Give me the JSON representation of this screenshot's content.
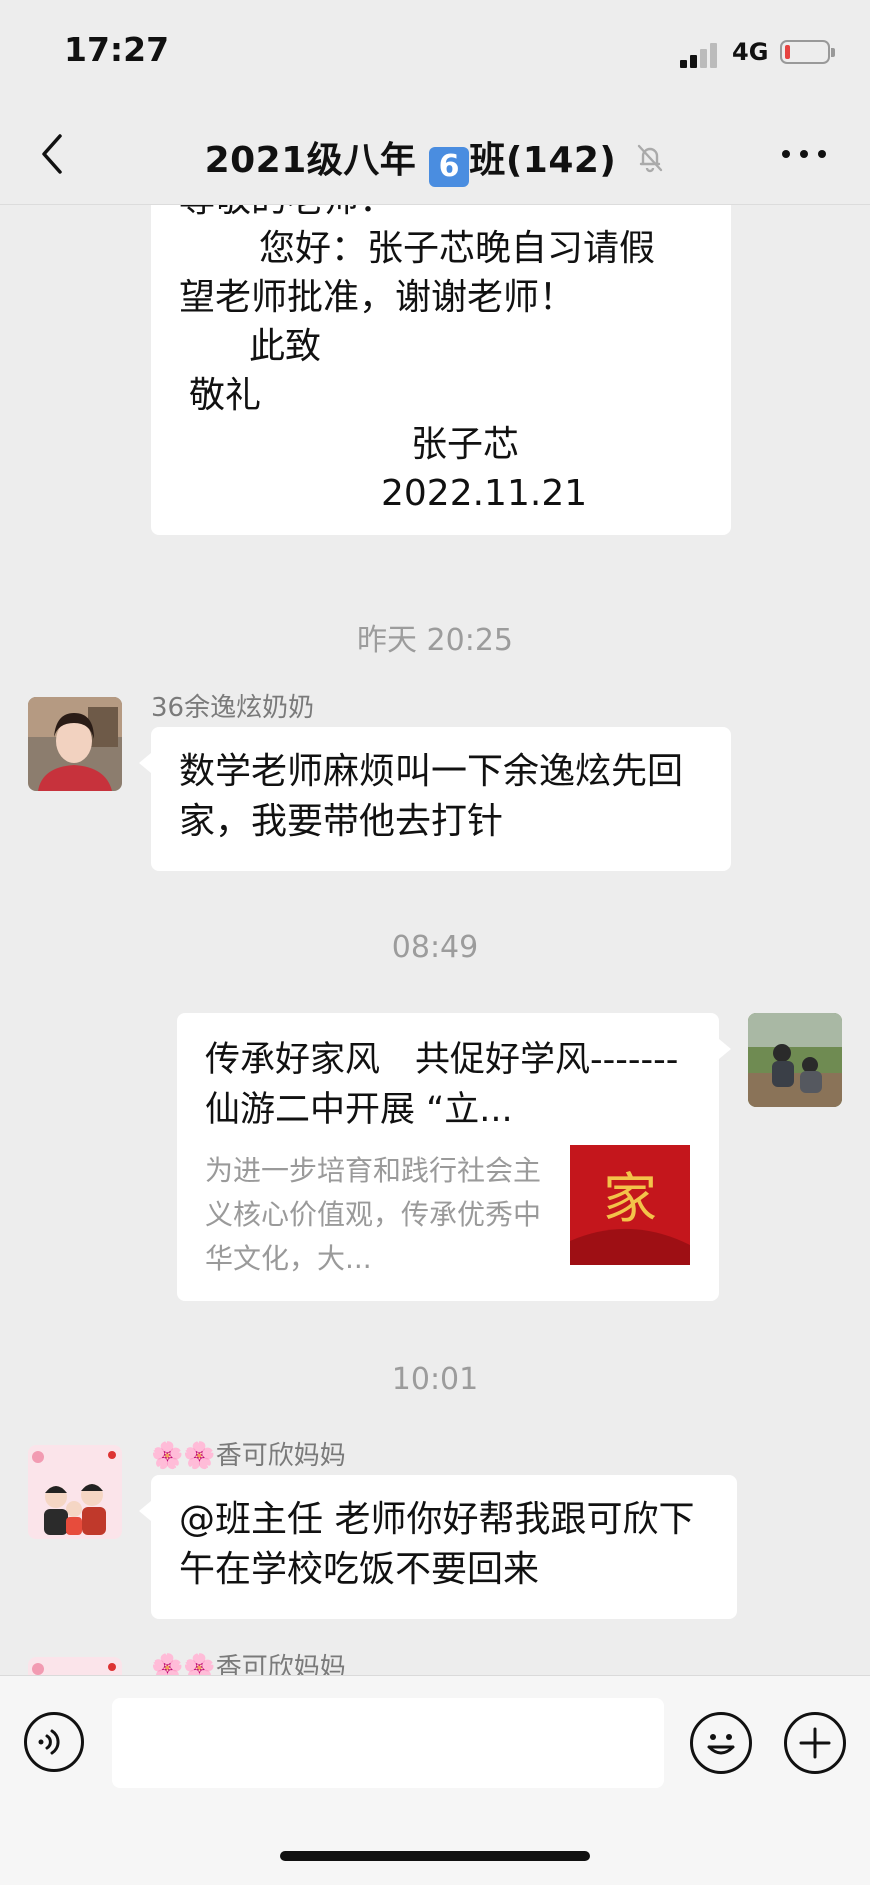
{
  "status_bar": {
    "time": "17:27",
    "network": "4G",
    "battery_color": "#e64340"
  },
  "nav": {
    "title": "2021级八年 6️⃣班(142)",
    "title_prefix": "2021级八年 ",
    "class_number": "6",
    "title_suffix": "班(142)",
    "muted_icon": "bell-mute-icon",
    "more_icon": "more-dots-icon",
    "back_icon": "chevron-left-icon"
  },
  "messages": {
    "letter": {
      "line1": "尊敬的老师：",
      "line2": "您好：张子芯晚自习请假",
      "line3": "望老师批准，谢谢老师！",
      "line4": "此致",
      "line5": "敬礼",
      "signature": "张子芯",
      "date": "2022.11.21"
    },
    "ts1": "昨天 20:25",
    "msg1": {
      "sender": "36余逸炫奶奶",
      "text": "数学老师麻烦叫一下余逸炫先回家，我要带他去打针"
    },
    "ts2": "08:49",
    "card": {
      "title": "传承好家风　共促好学风-------仙游二中开展 “立...",
      "desc": "为进一步培育和践行社会主义核心价值观，传承优秀中华文化，大...",
      "thumb_char": "家"
    },
    "ts3": "10:01",
    "msg2": {
      "sender": "🌸🌸香可欣妈妈",
      "text": "@班主任 老师你好帮我跟可欣下午在学校吃饭不要回来"
    },
    "msg3": {
      "sender": "🌸🌸香可欣妈妈"
    }
  },
  "input_bar": {
    "voice_icon": "voice-icon",
    "emoji_icon": "emoji-icon",
    "plus_icon": "plus-icon",
    "value": ""
  }
}
